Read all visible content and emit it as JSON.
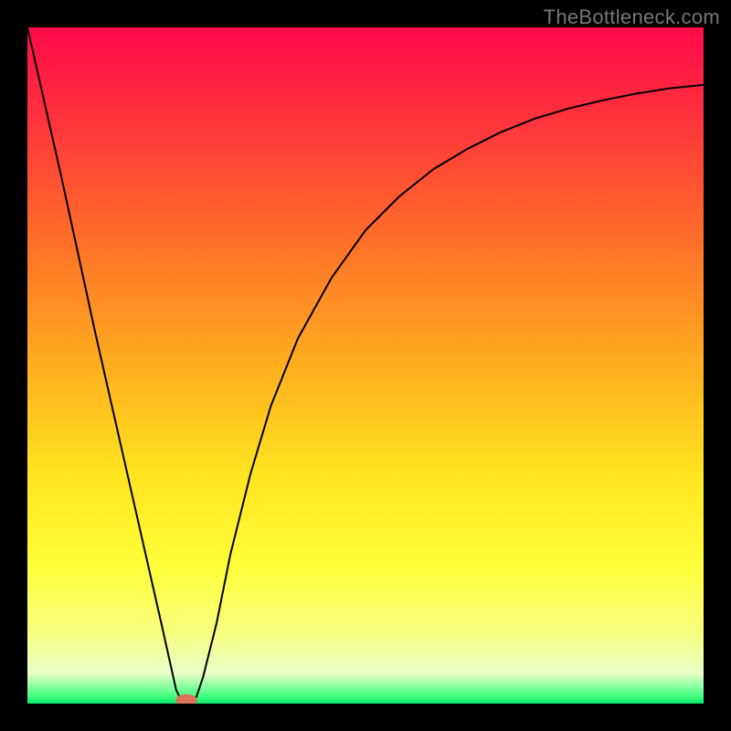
{
  "watermark": "TheBottleneck.com",
  "chart_data": {
    "type": "line",
    "title": "",
    "xlabel": "",
    "ylabel": "",
    "xlim": [
      0,
      100
    ],
    "ylim": [
      0,
      100
    ],
    "gradient_stops": [
      {
        "offset": 0,
        "color": "#ff0a4a"
      },
      {
        "offset": 0.12,
        "color": "#ff2e3f"
      },
      {
        "offset": 0.3,
        "color": "#ff6a2a"
      },
      {
        "offset": 0.5,
        "color": "#ffae1f"
      },
      {
        "offset": 0.66,
        "color": "#ffe41f"
      },
      {
        "offset": 0.8,
        "color": "#ffff3a"
      },
      {
        "offset": 0.9,
        "color": "#f6ff84"
      },
      {
        "offset": 0.955,
        "color": "#e9ffc8"
      },
      {
        "offset": 0.99,
        "color": "#3fff7e"
      },
      {
        "offset": 1.0,
        "color": "#00e56b"
      }
    ],
    "series": [
      {
        "name": "bottleneck-curve",
        "x": [
          0,
          5,
          10,
          15,
          20,
          22,
          23,
          24,
          25,
          26,
          28,
          30,
          33,
          36,
          40,
          45,
          50,
          55,
          60,
          65,
          70,
          75,
          80,
          85,
          90,
          95,
          100
        ],
        "values": [
          100,
          78,
          55,
          33,
          11,
          2,
          0,
          0,
          1,
          4,
          12,
          22,
          34,
          44,
          54,
          63,
          70,
          75,
          79,
          82,
          84.5,
          86.5,
          88,
          89.2,
          90.2,
          91,
          91.5
        ]
      }
    ],
    "marker": {
      "name": "optimal-point",
      "x": 23.5,
      "y": 0.5,
      "color": "#d9735a",
      "rx": 1.6,
      "ry": 0.9
    }
  }
}
